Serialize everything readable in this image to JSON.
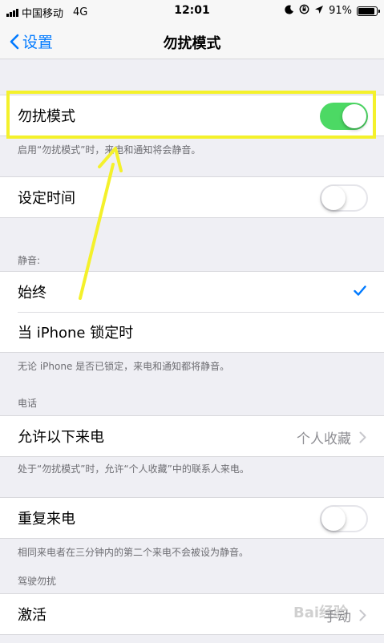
{
  "status_bar": {
    "carrier": "中国移动",
    "network": "4G",
    "time": "12:01",
    "battery_percent": "91%",
    "battery_level": 0.91,
    "icons": [
      "moon-icon",
      "orientation-lock-icon",
      "location-icon",
      "battery-icon"
    ]
  },
  "nav": {
    "back_label": "设置",
    "title": "勿扰模式"
  },
  "dnd": {
    "label": "勿扰模式",
    "on": true,
    "footnote": "启用“勿扰模式”时，来电和通知将会静音。"
  },
  "scheduled": {
    "label": "设定时间",
    "on": false
  },
  "silence": {
    "header": "静音:",
    "always_label": "始终",
    "locked_label": "当 iPhone 锁定时",
    "selected": "always",
    "footnote": "无论 iPhone 是否已锁定，来电和通知都将静音。"
  },
  "phone": {
    "header": "电话",
    "allow_calls_label": "允许以下来电",
    "allow_calls_value": "个人收藏",
    "allow_calls_footnote": "处于“勿扰模式”时，允许“个人收藏”中的联系人来电。",
    "repeated_label": "重复来电",
    "repeated_on": false,
    "repeated_footnote": "相同来电者在三分钟内的第二个来电不会被设为静音。"
  },
  "driving": {
    "header": "驾驶勿扰",
    "activate_label": "激活",
    "activate_value": "手动"
  },
  "watermark": "Bai经验",
  "colors": {
    "accent": "#007aff",
    "toggle_on": "#4cd964",
    "highlight": "#f4f12b",
    "background": "#efeff4"
  }
}
